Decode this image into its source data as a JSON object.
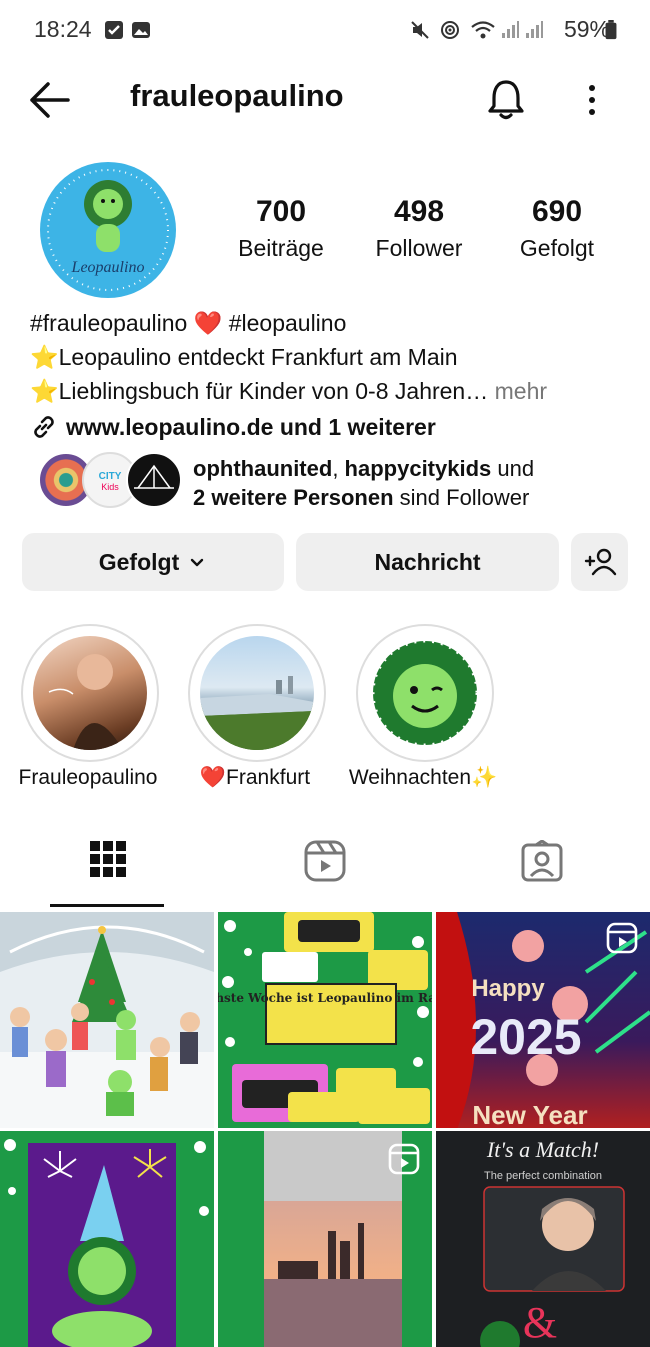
{
  "status_bar": {
    "time": "18:24",
    "battery": "59%"
  },
  "header": {
    "username": "frauleopaulino"
  },
  "profile": {
    "avatar_text": "Leopaulino",
    "stats": [
      {
        "value": "700",
        "label": "Beiträge"
      },
      {
        "value": "498",
        "label": "Follower"
      },
      {
        "value": "690",
        "label": "Gefolgt"
      }
    ]
  },
  "bio": {
    "line1": "#frauleopaulino ❤️ #leopaulino",
    "line2": "⭐Leopaulino entdeckt Frankfurt am Main",
    "line3": "⭐Lieblingsbuch für Kinder von 0-8 Jahren…",
    "more": " mehr",
    "link": "www.leopaulino.de und 1 weiterer"
  },
  "followed_by": {
    "name1": "ophthaunited",
    "sep": ", ",
    "name2": "happycitykids",
    "and": " und",
    "others": "2 weitere Personen",
    "suffix": " sind Follower"
  },
  "buttons": {
    "following": "Gefolgt",
    "message": "Nachricht"
  },
  "highlights": [
    {
      "label": "Frauleopaulino"
    },
    {
      "label": "❤️Frankfurt"
    },
    {
      "label": "Weihnachten✨"
    }
  ],
  "grid": {
    "post2_text": "Nächste Woche ist Leopaulino im Radio!!!",
    "post3_top": "Happy",
    "post3_year": "2025",
    "post3_bottom": "New Year",
    "post6_title": "It's a Match!",
    "post6_sub": "The perfect combination"
  }
}
